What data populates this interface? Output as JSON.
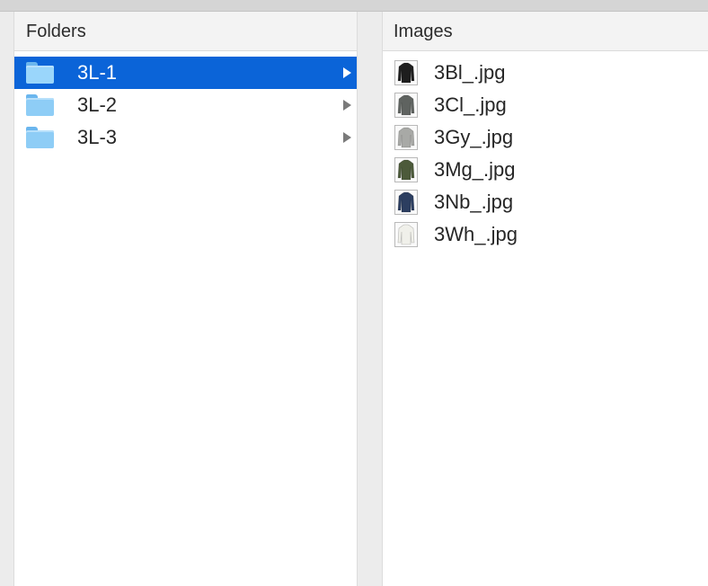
{
  "folders_pane": {
    "header": "Folders",
    "items": [
      {
        "label": "3L-1",
        "selected": true
      },
      {
        "label": "3L-2",
        "selected": false
      },
      {
        "label": "3L-3",
        "selected": false
      }
    ]
  },
  "images_pane": {
    "header": "Images",
    "items": [
      {
        "label": "3Bl_.jpg",
        "shirt_color": "#1e1e1e"
      },
      {
        "label": "3Cl_.jpg",
        "shirt_color": "#5f6360"
      },
      {
        "label": "3Gy_.jpg",
        "shirt_color": "#a8a9a6"
      },
      {
        "label": "3Mg_.jpg",
        "shirt_color": "#4c5a3a"
      },
      {
        "label": "3Nb_.jpg",
        "shirt_color": "#2c3e60"
      },
      {
        "label": "3Wh_.jpg",
        "shirt_color": "#f0f0ea"
      }
    ]
  },
  "colors": {
    "selection": "#0b64d8",
    "folder_blue": "#8ecdf6"
  }
}
